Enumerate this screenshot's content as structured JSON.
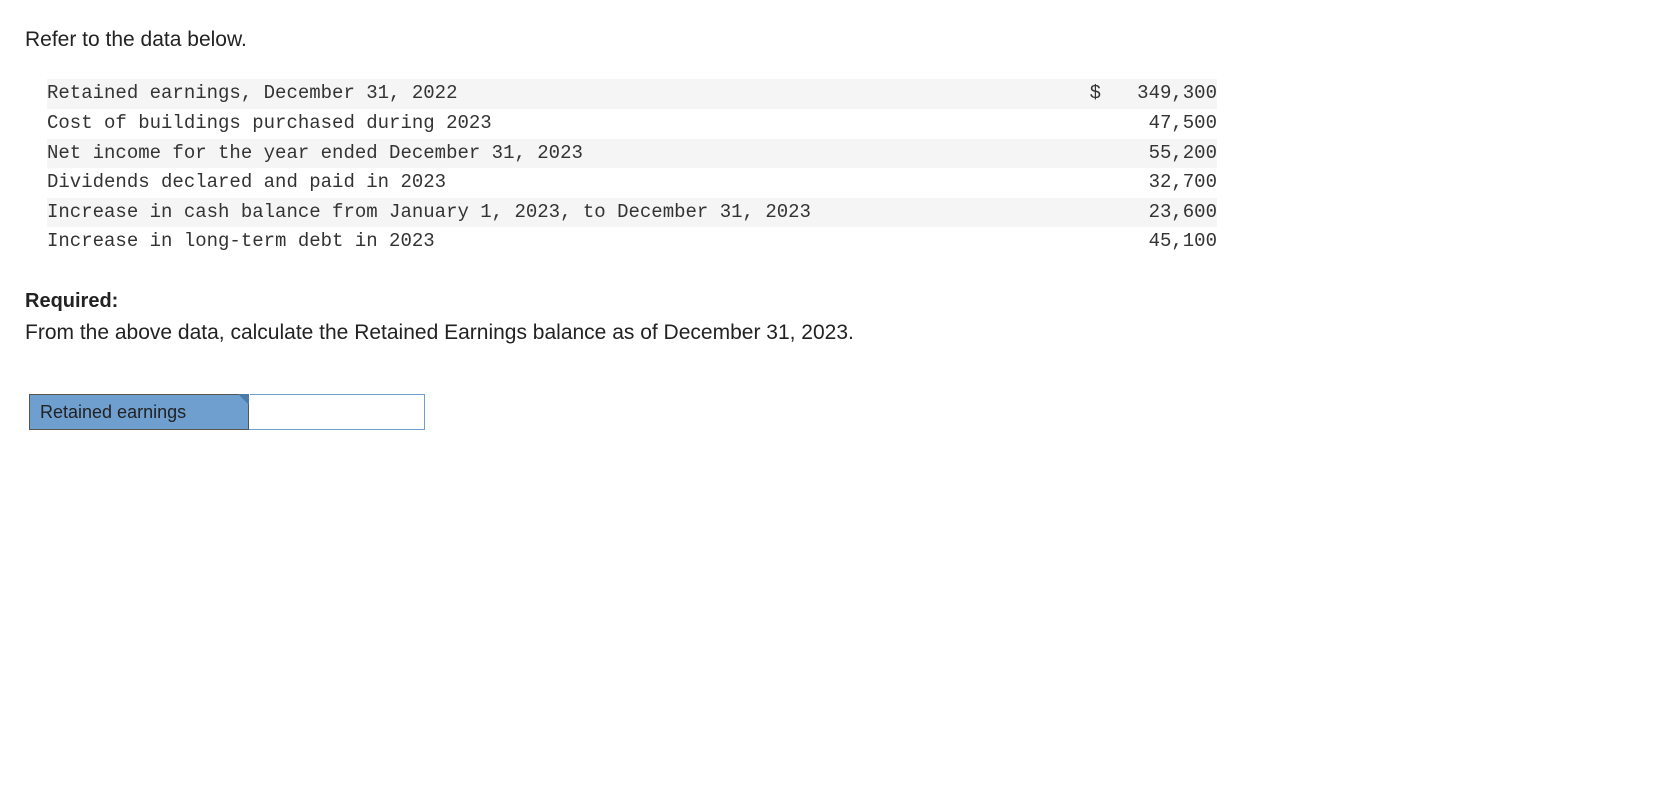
{
  "intro": "Refer to the data below.",
  "data_rows": [
    {
      "label": "Retained earnings, December 31, 2022",
      "currency": "$",
      "value": "349,300"
    },
    {
      "label": "Cost of buildings purchased during 2023",
      "currency": "",
      "value": "47,500"
    },
    {
      "label": "Net income for the year ended December 31, 2023",
      "currency": "",
      "value": "55,200"
    },
    {
      "label": "Dividends declared and paid in 2023",
      "currency": "",
      "value": "32,700"
    },
    {
      "label": "Increase in cash balance from January 1, 2023, to December 31, 2023",
      "currency": "",
      "value": "23,600"
    },
    {
      "label": "Increase in long-term debt in 2023",
      "currency": "",
      "value": "45,100"
    }
  ],
  "required_heading": "Required:",
  "required_text": "From the above data, calculate the Retained Earnings balance as of December 31, 2023.",
  "answer_label": "Retained earnings",
  "answer_value": ""
}
